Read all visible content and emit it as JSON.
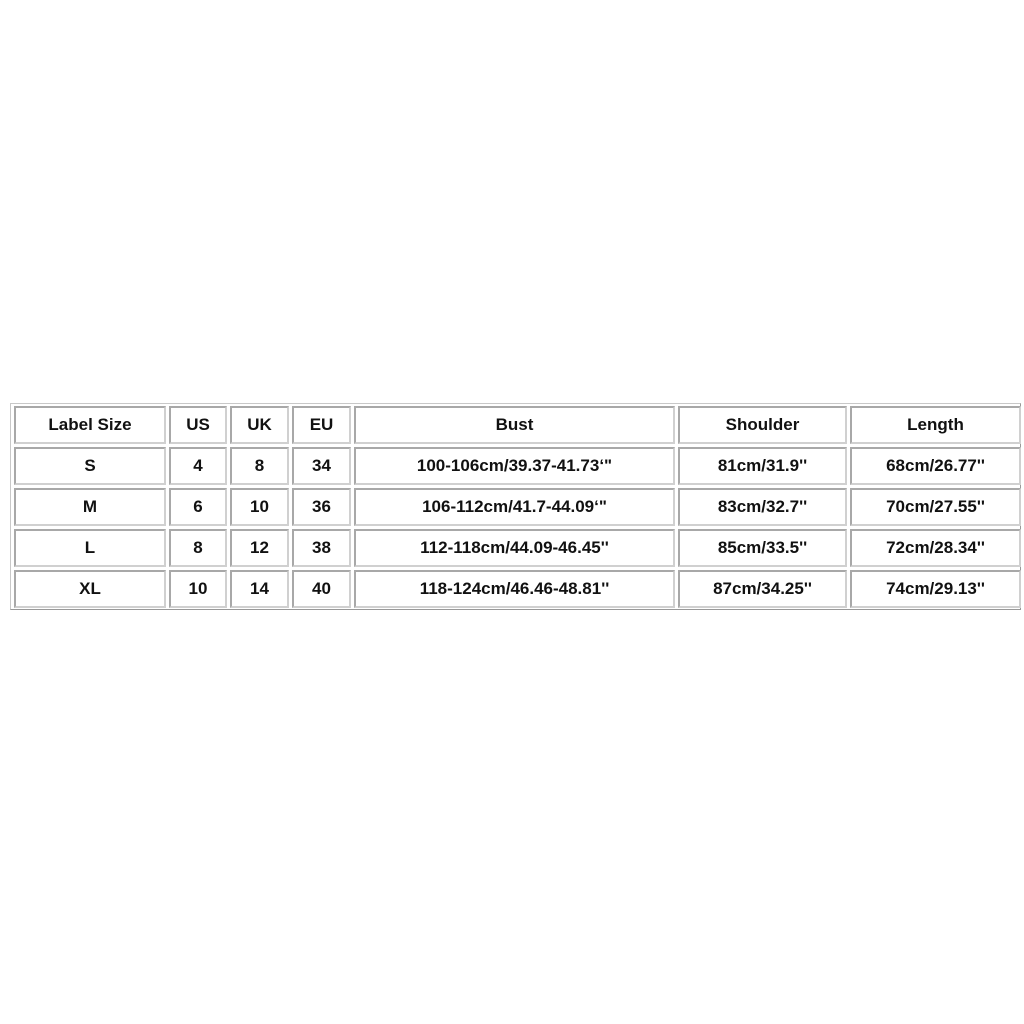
{
  "size_chart": {
    "headers": [
      "Label Size",
      "US",
      "UK",
      "EU",
      "Bust",
      "Shoulder",
      "Length"
    ],
    "rows": [
      [
        "S",
        "4",
        "8",
        "34",
        "100-106cm/39.37-41.73‘\"",
        "81cm/31.9''",
        "68cm/26.77''"
      ],
      [
        "M",
        "6",
        "10",
        "36",
        "106-112cm/41.7-44.09‘\"",
        "83cm/32.7''",
        "70cm/27.55''"
      ],
      [
        "L",
        "8",
        "12",
        "38",
        "112-118cm/44.09-46.45''",
        "85cm/33.5''",
        "72cm/28.34''"
      ],
      [
        "XL",
        "10",
        "14",
        "40",
        "118-124cm/46.46-48.81''",
        "87cm/34.25''",
        "74cm/29.13''"
      ]
    ]
  }
}
